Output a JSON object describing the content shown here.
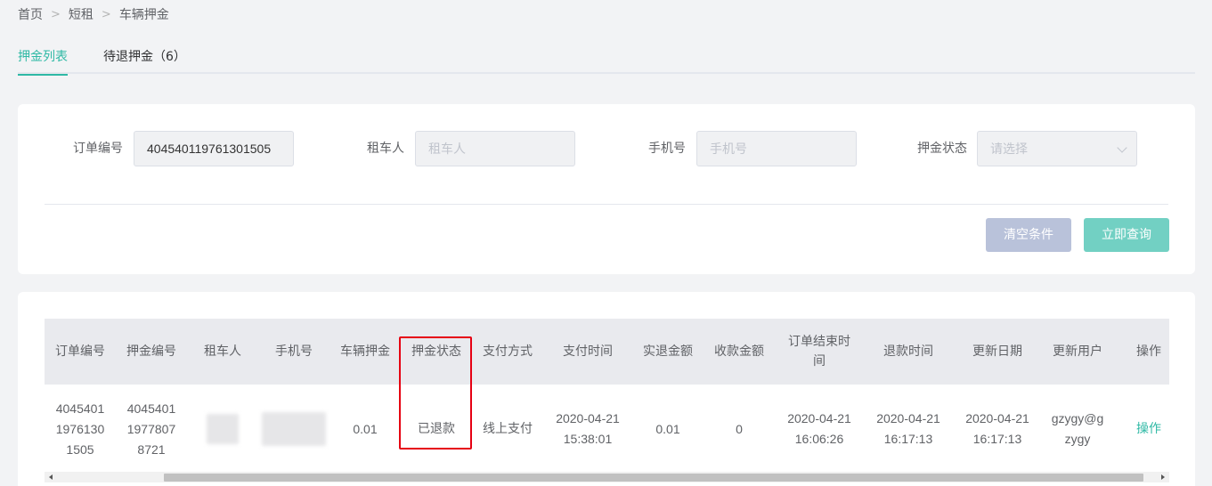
{
  "breadcrumb": [
    "首页",
    "短租",
    "车辆押金"
  ],
  "tabs": [
    {
      "label": "押金列表",
      "active": true
    },
    {
      "label": "待退押金（6）",
      "active": false
    }
  ],
  "search": {
    "order_no": {
      "label": "订单编号",
      "value": "404540119761301505"
    },
    "renter": {
      "label": "租车人",
      "placeholder": "租车人"
    },
    "phone": {
      "label": "手机号",
      "placeholder": "手机号"
    },
    "deposit_status": {
      "label": "押金状态",
      "placeholder": "请选择"
    },
    "clear_label": "清空条件",
    "query_label": "立即查询"
  },
  "table": {
    "headers": [
      "订单编号",
      "押金编号",
      "租车人",
      "手机号",
      "车辆押金",
      "押金状态",
      "支付方式",
      "支付时间",
      "实退金额",
      "收款金额",
      "订单结束时间",
      "退款时间",
      "更新日期",
      "更新用户",
      "操作"
    ],
    "rows": [
      {
        "order_no": "404540119761301505",
        "deposit_no": "404540119778078721",
        "renter": "",
        "phone": "",
        "vehicle_deposit": "0.01",
        "deposit_status": "已退款",
        "pay_method": "线上支付",
        "pay_time": "2020-04-21 15:38:01",
        "refund_amount": "0.01",
        "received_amount": "0",
        "order_end_time": "2020-04-21 16:06:26",
        "refund_time": "2020-04-21 16:17:13",
        "update_date": "2020-04-21 16:17:13",
        "update_user": "gzygy@gzygy",
        "action": "操作"
      }
    ]
  },
  "colors": {
    "accent": "#2fb9a5",
    "highlight": "#e60012"
  }
}
